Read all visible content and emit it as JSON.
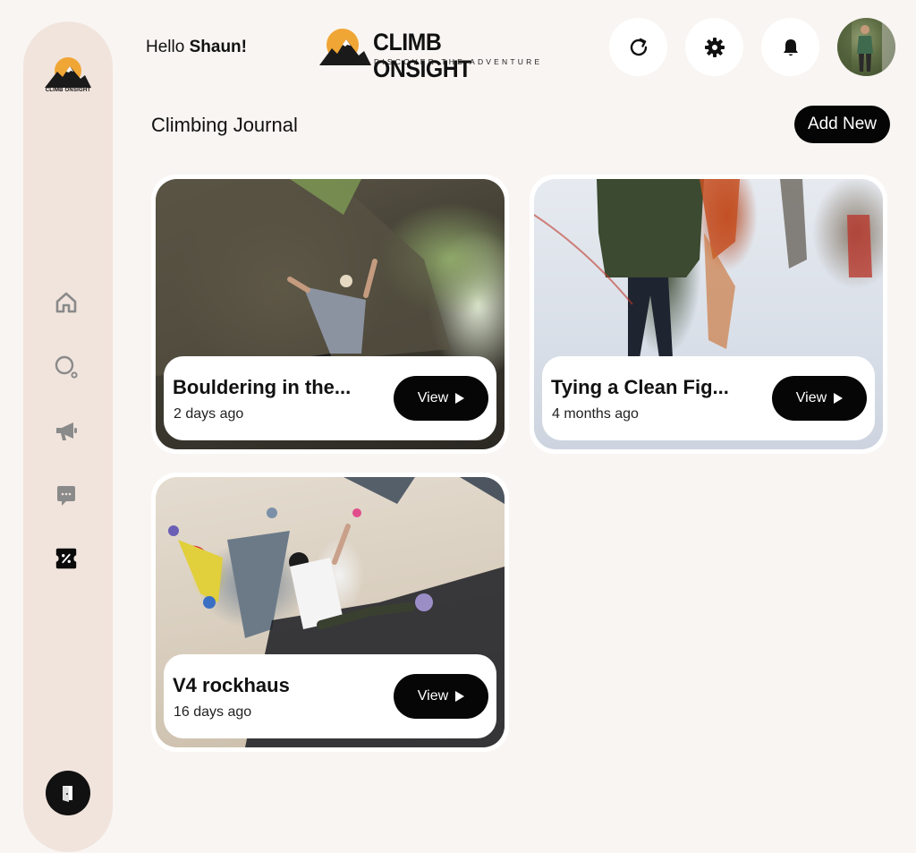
{
  "sidebar": {
    "logo_text": "CLIMB ONSIGHT",
    "nav": [
      {
        "name": "home",
        "icon": "home-icon"
      },
      {
        "name": "search",
        "icon": "search-icon"
      },
      {
        "name": "announcements",
        "icon": "megaphone-icon"
      },
      {
        "name": "messages",
        "icon": "chat-icon"
      },
      {
        "name": "journal",
        "icon": "ticket-icon",
        "active": true
      }
    ],
    "logout_icon": "logout-icon"
  },
  "header": {
    "greeting": "Hello",
    "user_name": "Shaun!",
    "brand_name": "CLIMB ONSIGHT",
    "brand_tagline": "DISCOVER THE ADVENTURE",
    "actions": [
      "refresh-icon",
      "gear-icon",
      "bell-icon"
    ]
  },
  "page": {
    "title": "Climbing Journal",
    "add_new_label": "Add New"
  },
  "entries": [
    {
      "title": "Bouldering in the...",
      "date": "2 days ago",
      "view_label": "View"
    },
    {
      "title": "Tying a Clean Fig...",
      "date": "4 months ago",
      "view_label": "View"
    },
    {
      "title": "V4 rockhaus",
      "date": "16 days ago",
      "view_label": "View"
    }
  ],
  "colors": {
    "background": "#f9f5f2",
    "sidebar": "#f1e4dd",
    "accent_sun": "#f0a635",
    "button": "#050505"
  }
}
